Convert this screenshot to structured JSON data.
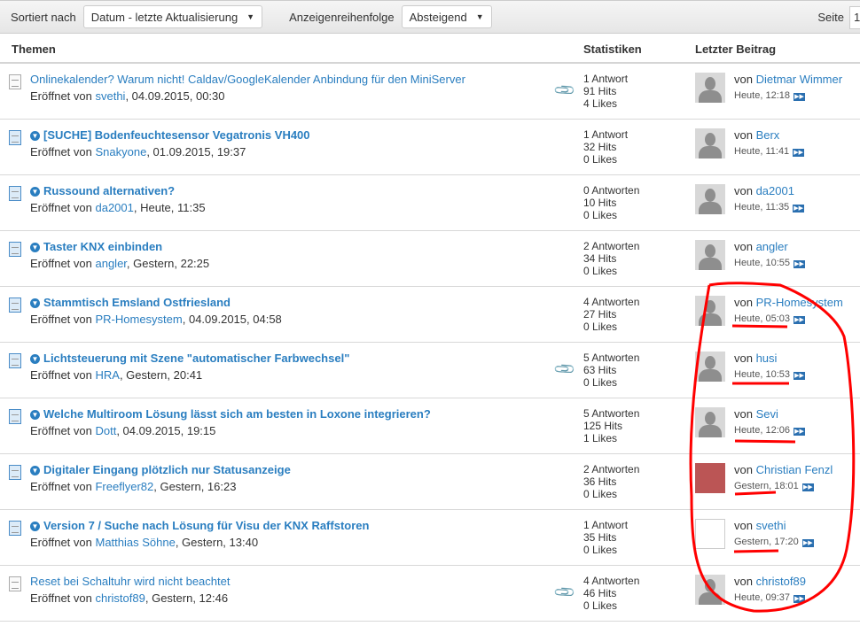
{
  "toolbar": {
    "sort_label": "Sortiert nach",
    "sort_value": "Datum - letzte Aktualisierung",
    "order_label": "Anzeigenreihenfolge",
    "order_value": "Absteigend",
    "page_label": "Seite",
    "page_value": "1"
  },
  "header": {
    "topics": "Themen",
    "stats": "Statistiken",
    "last": "Letzter Beitrag"
  },
  "opened_by": "Eröffnet von ",
  "by": "von ",
  "threads": [
    {
      "title": "Onlinekalender? Warum nicht! Caldav/GoogleKalender Anbindung für den MiniServer",
      "unread": false,
      "author": "svethi",
      "date": ", 04.09.2015, 00:30",
      "attach": true,
      "replies": "1 Antwort",
      "hits": "91 Hits",
      "likes": "4 Likes",
      "last_user": "Dietmar Wimmer",
      "last_time": "Heute, 12:18",
      "avatar": "default"
    },
    {
      "title": "[SUCHE] Bodenfeuchtesensor Vegatronis VH400",
      "unread": true,
      "author": "Snakyone",
      "date": ", 01.09.2015, 19:37",
      "attach": false,
      "replies": "1 Antwort",
      "hits": "32 Hits",
      "likes": "0 Likes",
      "last_user": "Berx",
      "last_time": "Heute, 11:41",
      "avatar": "default"
    },
    {
      "title": "Russound alternativen?",
      "unread": true,
      "author": "da2001",
      "date": ", Heute, 11:35",
      "attach": false,
      "replies": "0 Antworten",
      "hits": "10 Hits",
      "likes": "0 Likes",
      "last_user": "da2001",
      "last_time": "Heute, 11:35",
      "avatar": "default"
    },
    {
      "title": "Taster KNX einbinden",
      "unread": true,
      "author": "angler",
      "date": ", Gestern, 22:25",
      "attach": false,
      "replies": "2 Antworten",
      "hits": "34 Hits",
      "likes": "0 Likes",
      "last_user": "angler",
      "last_time": "Heute, 10:55",
      "avatar": "default"
    },
    {
      "title": "Stammtisch Emsland Ostfriesland",
      "unread": true,
      "author": "PR-Homesystem",
      "date": ", 04.09.2015, 04:58",
      "attach": false,
      "replies": "4 Antworten",
      "hits": "27 Hits",
      "likes": "0 Likes",
      "last_user": "PR-Homesystem",
      "last_time": "Heute, 05:03",
      "avatar": "default"
    },
    {
      "title": "Lichtsteuerung mit Szene \"automatischer Farbwechsel\"",
      "unread": true,
      "author": "HRA",
      "date": ", Gestern, 20:41",
      "attach": true,
      "replies": "5 Antworten",
      "hits": "63 Hits",
      "likes": "0 Likes",
      "last_user": "husi",
      "last_time": "Heute, 10:53",
      "avatar": "default"
    },
    {
      "title": "Welche Multiroom Lösung lässt sich am besten in Loxone integrieren?",
      "unread": true,
      "author": "Dott",
      "date": ", 04.09.2015, 19:15",
      "attach": false,
      "replies": "5 Antworten",
      "hits": "125 Hits",
      "likes": "1 Likes",
      "last_user": "Sevi",
      "last_time": "Heute, 12:06",
      "avatar": "default"
    },
    {
      "title": "Digitaler Eingang plötzlich nur Statusanzeige",
      "unread": true,
      "author": "Freeflyer82",
      "date": ", Gestern, 16:23",
      "attach": false,
      "replies": "2 Antworten",
      "hits": "36 Hits",
      "likes": "0 Likes",
      "last_user": "Christian Fenzl",
      "last_time": "Gestern, 18:01",
      "avatar": "photo"
    },
    {
      "title": "Version 7 / Suche nach Lösung für Visu der KNX Raffstoren",
      "unread": true,
      "author": "Matthias Söhne",
      "date": ", Gestern, 13:40",
      "attach": false,
      "replies": "1 Antwort",
      "hits": "35 Hits",
      "likes": "0 Likes",
      "last_user": "svethi",
      "last_time": "Gestern, 17:20",
      "avatar": "sketch"
    },
    {
      "title": "Reset bei Schaltuhr wird nicht beachtet",
      "unread": false,
      "author": "christof89",
      "date": ", Gestern, 12:46",
      "attach": true,
      "replies": "4 Antworten",
      "hits": "46 Hits",
      "likes": "0 Likes",
      "last_user": "christof89",
      "last_time": "Heute, 09:37",
      "avatar": "default"
    }
  ],
  "colors": {
    "link": "#2a7ec0",
    "annotation": "#ff0000"
  }
}
